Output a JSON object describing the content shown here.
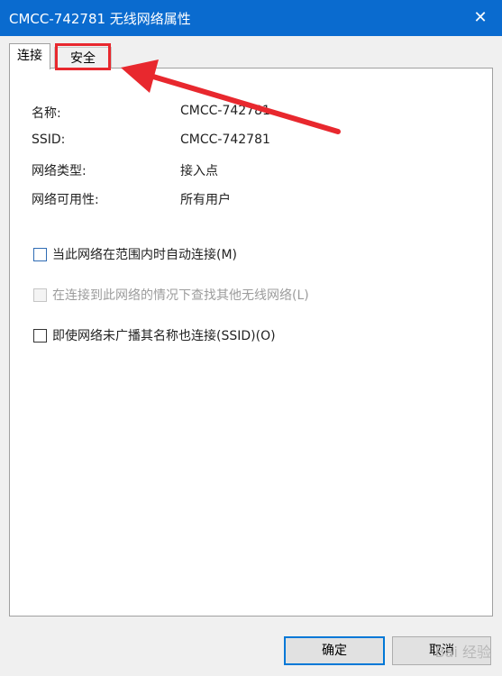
{
  "window": {
    "title": "CMCC-742781 无线网络属性",
    "close_symbol": "✕"
  },
  "tabs": [
    {
      "label": "连接"
    },
    {
      "label": "安全"
    }
  ],
  "properties": [
    {
      "label": "名称:",
      "value": "CMCC-742781"
    },
    {
      "label": "SSID:",
      "value": "CMCC-742781"
    },
    {
      "label": "网络类型:",
      "value": "接入点"
    },
    {
      "label": "网络可用性:",
      "value": "所有用户"
    }
  ],
  "options": [
    {
      "label": "当此网络在范围内时自动连接(M)",
      "checked": false,
      "enabled": true
    },
    {
      "label": "在连接到此网络的情况下查找其他无线网络(L)",
      "checked": false,
      "enabled": false
    },
    {
      "label": "即使网络未广播其名称也连接(SSID)(O)",
      "checked": false,
      "enabled": true
    }
  ],
  "buttons": {
    "ok": "确定",
    "cancel": "取消"
  },
  "annotation": {
    "color": "#e8282e"
  },
  "watermark": "Bai 经验"
}
